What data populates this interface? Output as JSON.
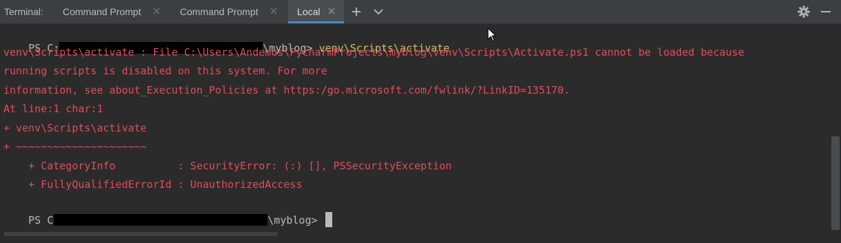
{
  "toolbar": {
    "label": "Terminal:",
    "tabs": [
      {
        "label": "Command Prompt"
      },
      {
        "label": "Command Prompt"
      },
      {
        "label": "Local"
      }
    ],
    "icons": [
      "close-icon",
      "plus-icon",
      "chevron-down-icon",
      "gear-icon",
      "minimize-icon"
    ],
    "accent_color": "#4a88c7"
  },
  "terminal": {
    "colors": {
      "prompt": "#bbbbbb",
      "command": "#d8c05a",
      "error": "#e24c5b"
    },
    "prompt1_start": "PS C:",
    "prompt1_end": "\\myblog> ",
    "command": "venv\\Scripts\\activate",
    "error_lines": [
      "venv\\Scripts\\activate : File C:\\Users\\Andemus\\PycharmProjects\\myblog\\venv\\Scripts\\Activate.ps1 cannot be loaded because",
      "running scripts is disabled on this system. For more",
      "information, see about_Execution_Policies at https:/go.microsoft.com/fwlink/?LinkID=135170.",
      "At line:1 char:1",
      "+ venv\\Scripts\\activate",
      "+ ~~~~~~~~~~~~~~~~~~~~~",
      "    + CategoryInfo          : SecurityError: (:) [], PSSecurityException",
      "    + FullyQualifiedErrorId : UnauthorizedAccess"
    ],
    "prompt2_start": "PS C:",
    "prompt2_end": "\\myblog> "
  }
}
